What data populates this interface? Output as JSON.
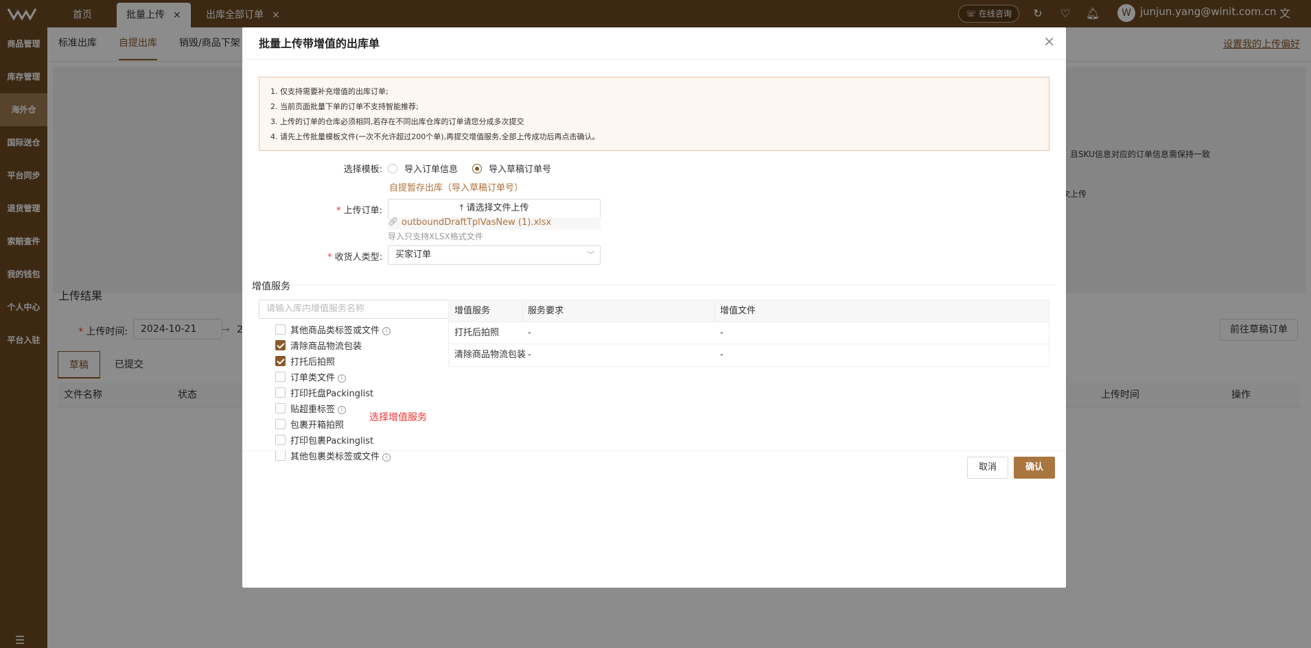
{
  "topbar": {
    "tabs": [
      {
        "label": "首页"
      },
      {
        "label": "批量上传"
      },
      {
        "label": "出库全部订单"
      }
    ],
    "close_glyph": "×",
    "consult_label": "在线咨询",
    "user_email": "junjun.yang@winit.com.cn",
    "icons": [
      "refresh-icon",
      "heart-shield-icon",
      "bell-icon",
      "translate-icon"
    ]
  },
  "sidebar": {
    "items": [
      {
        "label": "商品管理"
      },
      {
        "label": "库存管理"
      },
      {
        "label": "海外仓"
      },
      {
        "label": "国际送仓"
      },
      {
        "label": "平台同步"
      },
      {
        "label": "退货管理"
      },
      {
        "label": "索赔查件"
      },
      {
        "label": "我的钱包"
      },
      {
        "label": "个人中心"
      },
      {
        "label": "平台入驻"
      }
    ],
    "active_index": 2
  },
  "background": {
    "subnav": [
      {
        "label": "标准出库"
      },
      {
        "label": "自提出库"
      },
      {
        "label": "销毁/商品下架"
      }
    ],
    "pref_link": "设置我的上传偏好",
    "hint_right_1": "，且SKU信息对应的订单信息需保持一致",
    "hint_right_2": "次上传",
    "result_title": "上传结果",
    "upload_time_label": "上传时间:",
    "upload_time_value": "2024-10-21",
    "range_arrow": "→",
    "range_end_partial": "2",
    "goto_draft_button": "前往草稿订单",
    "tabs": [
      {
        "label": "草稿"
      },
      {
        "label": "已提交"
      }
    ],
    "table_headers": [
      "文件名称",
      "状态",
      "上传时间",
      "操作"
    ]
  },
  "modal": {
    "title": "批量上传带增值的出库单",
    "notice": [
      "1. 仅支持需要补充增值的出库订单;",
      "2. 当前页面批量下单的订单不支持智能推荐;",
      "3. 上传的订单的仓库必须相同,若存在不同出库仓库的订单请您分成多次提交",
      "4. 请先上传批量模板文件(一次不允许超过200个单),再提交增值服务,全部上传成功后再点击确认。"
    ],
    "template_label": "选择模板:",
    "template_options": [
      {
        "label": "导入订单信息",
        "checked": false
      },
      {
        "label": "导入草稿订单号",
        "checked": true
      }
    ],
    "template_link": "自提暂存出库（导入草稿订单号）",
    "upload_label": "上传订单:",
    "upload_button": "请选择文件上传",
    "uploaded_file": "outboundDraftTplVasNew (1).xlsx",
    "upload_hint": "导入只支持XLSX格式文件",
    "receiver_label": "收货人类型:",
    "receiver_value": "买家订单",
    "vas_section_title": "增值服务",
    "vas_search_placeholder": "请输入库内增值服务名称",
    "vas_options": [
      {
        "label": "其他商品类标签或文件",
        "checked": false,
        "info": true
      },
      {
        "label": "清除商品物流包装",
        "checked": true,
        "info": false
      },
      {
        "label": "打托后拍照",
        "checked": true,
        "info": false
      },
      {
        "label": "订单类文件",
        "checked": false,
        "info": true
      },
      {
        "label": "打印托盘Packinglist",
        "checked": false,
        "info": false
      },
      {
        "label": "贴超重标签",
        "checked": false,
        "info": true
      },
      {
        "label": "包裹开箱拍照",
        "checked": false,
        "info": false
      },
      {
        "label": "打印包裹Packinglist",
        "checked": false,
        "info": false
      },
      {
        "label": "其他包裹类标签或文件",
        "checked": false,
        "info": true
      }
    ],
    "pick_note": "选择增值服务",
    "vas_table": {
      "headers": [
        "增值服务",
        "服务要求",
        "增值文件"
      ],
      "rows": [
        [
          "打托后拍照",
          "-",
          "-"
        ],
        [
          "清除商品物流包装",
          "-",
          "-"
        ]
      ]
    },
    "cancel_button": "取消",
    "confirm_button": "确认"
  },
  "colors": {
    "brand": "#704b24",
    "accent": "#a9763f",
    "link": "#b0703a",
    "required": "#e33333"
  }
}
